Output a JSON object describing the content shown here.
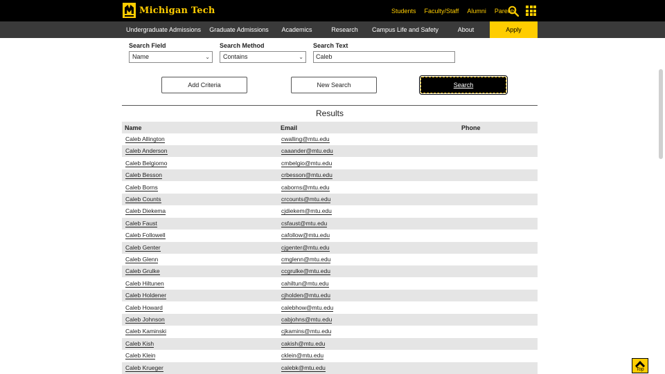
{
  "brand": {
    "name": "Michigan Tech",
    "logo_icon": "mtu-logo-icon",
    "accent": "#ffcd00"
  },
  "utility_nav": [
    "Students",
    "Faculty/Staff",
    "Alumni",
    "Parents"
  ],
  "main_nav": [
    "Undergraduate Admissions",
    "Graduate Admissions",
    "Academics",
    "Research",
    "Campus Life and Safety",
    "About",
    "Apply"
  ],
  "search_form": {
    "field_label": "Search Field",
    "field_value": "Name",
    "method_label": "Search Method",
    "method_value": "Contains",
    "text_label": "Search Text",
    "text_value": "Caleb"
  },
  "buttons": {
    "add_criteria": "Add Criteria",
    "new_search": "New Search",
    "search": "Search"
  },
  "results": {
    "title": "Results",
    "columns": [
      "Name",
      "Email",
      "Phone"
    ],
    "rows": [
      {
        "name": "Caleb Allington",
        "email": "cwalling@mtu.edu"
      },
      {
        "name": "Caleb Anderson",
        "email": "caaander@mtu.edu"
      },
      {
        "name": "Caleb Belgiorno",
        "email": "cmbelgio@mtu.edu"
      },
      {
        "name": "Caleb Besson",
        "email": "crbesson@mtu.edu"
      },
      {
        "name": "Caleb Borns",
        "email": "caborns@mtu.edu"
      },
      {
        "name": "Caleb Counts",
        "email": "crcounts@mtu.edu"
      },
      {
        "name": "Caleb Diekema",
        "email": "cjdiekem@mtu.edu"
      },
      {
        "name": "Caleb Faust",
        "email": "csfaust@mtu.edu"
      },
      {
        "name": "Caleb Followell",
        "email": "cafollow@mtu.edu"
      },
      {
        "name": "Caleb Genter",
        "email": "cjgenter@mtu.edu"
      },
      {
        "name": "Caleb Glenn",
        "email": "cmglenn@mtu.edu"
      },
      {
        "name": "Caleb Grulke",
        "email": "ccgrulke@mtu.edu"
      },
      {
        "name": "Caleb Hiltunen",
        "email": "cahiltun@mtu.edu"
      },
      {
        "name": "Caleb Holdener",
        "email": "cjholden@mtu.edu"
      },
      {
        "name": "Caleb Howard",
        "email": "calebhow@mtu.edu"
      },
      {
        "name": "Caleb Johnson",
        "email": "cabjohns@mtu.edu"
      },
      {
        "name": "Caleb Kaminski",
        "email": "cjkamins@mtu.edu"
      },
      {
        "name": "Caleb Kish",
        "email": "cakish@mtu.edu"
      },
      {
        "name": "Caleb Klein",
        "email": "cklein@mtu.edu"
      },
      {
        "name": "Caleb Krueger",
        "email": "calebk@mtu.edu"
      }
    ]
  },
  "back_to_top": "Top",
  "icons": {
    "search": "search-icon",
    "menu": "apps-grid-icon",
    "top": "chevron-up-icon",
    "select": "chevron-down-icon"
  }
}
